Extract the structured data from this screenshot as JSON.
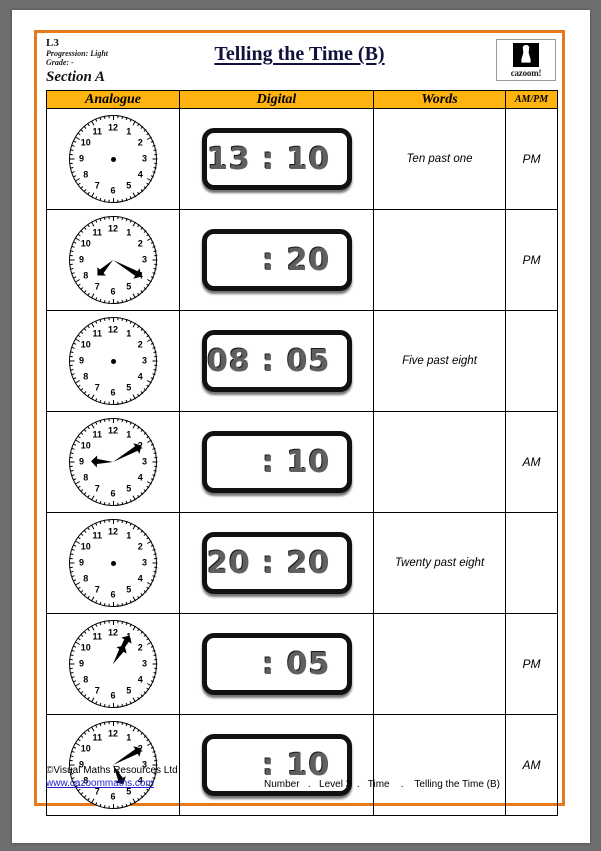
{
  "header": {
    "level_code": "L3",
    "progression": "Progression: Light",
    "grade": "Grade: -",
    "title": "Telling the Time (B)",
    "section_label": "Section A",
    "logo_word": "cazoom!"
  },
  "table": {
    "columns": [
      "Analogue",
      "Digital",
      "Words",
      "AM/PM"
    ],
    "rows": [
      {
        "analogue": {
          "has_hands": false,
          "hour_angle": null,
          "minute_angle": null
        },
        "digital": "13 : 10",
        "words": "Ten past one",
        "ampm": "PM"
      },
      {
        "analogue": {
          "has_hands": true,
          "hour_angle": 225,
          "minute_angle": 120
        },
        "digital": ": 20",
        "words": "",
        "ampm": "PM"
      },
      {
        "analogue": {
          "has_hands": false,
          "hour_angle": null,
          "minute_angle": null
        },
        "digital": "08 : 05",
        "words": "Five past eight",
        "ampm": ""
      },
      {
        "analogue": {
          "has_hands": true,
          "hour_angle": 272,
          "minute_angle": 60
        },
        "digital": ": 10",
        "words": "",
        "ampm": "AM"
      },
      {
        "analogue": {
          "has_hands": false,
          "hour_angle": null,
          "minute_angle": null
        },
        "digital": "20 : 20",
        "words": "Twenty past eight",
        "ampm": ""
      },
      {
        "analogue": {
          "has_hands": true,
          "hour_angle": 32,
          "minute_angle": 30
        },
        "digital": ": 05",
        "words": "",
        "ampm": "PM"
      },
      {
        "analogue": {
          "has_hands": true,
          "hour_angle": 152,
          "minute_angle": 60
        },
        "digital": ": 10",
        "words": "",
        "ampm": "AM"
      }
    ]
  },
  "clock_numbers": [
    "12",
    "1",
    "2",
    "3",
    "4",
    "5",
    "6",
    "7",
    "8",
    "9",
    "10",
    "11"
  ],
  "footer": {
    "copyright": "©Visual Maths Resources Ltd",
    "website": "www.cazoommaths.com",
    "breadcrumb": "Number   .   Level 3  .   Time    .    Telling the Time (B)"
  },
  "colors": {
    "header_fill": "#ffb310",
    "frame_border": "#e8791a",
    "link": "#2222cc",
    "page_background": "#6e6e6e"
  }
}
